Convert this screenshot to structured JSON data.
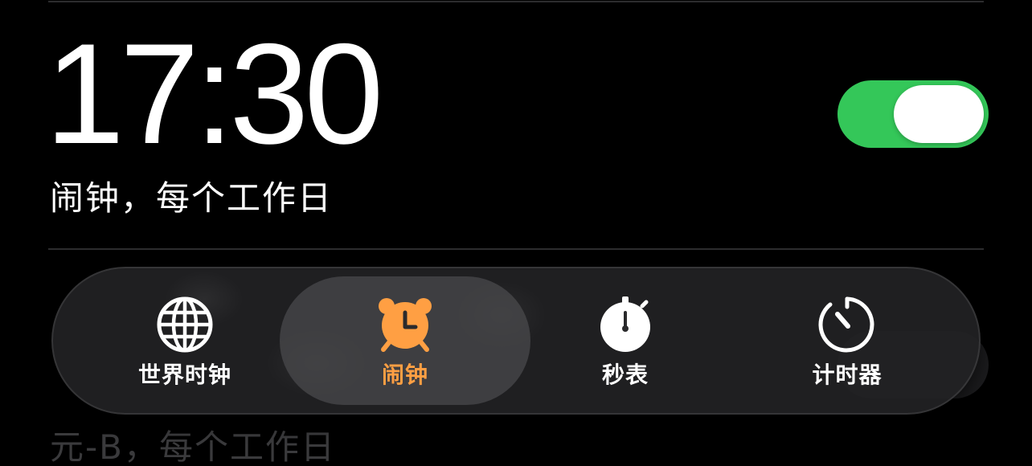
{
  "alarms": [
    {
      "time": "17:30",
      "label": "闹钟，每个工作日",
      "enabled": true
    },
    {
      "label": "元-B，每个工作日"
    }
  ],
  "tabbar": {
    "tabs": [
      {
        "label": "世界时钟",
        "icon": "globe-icon",
        "active": false
      },
      {
        "label": "闹钟",
        "icon": "alarm-clock-icon",
        "active": true
      },
      {
        "label": "秒表",
        "icon": "stopwatch-icon",
        "active": false
      },
      {
        "label": "计时器",
        "icon": "timer-icon",
        "active": false
      }
    ]
  },
  "colors": {
    "toggle_on": "#34c759",
    "active_tab": "#ff9f43",
    "background": "#000000"
  }
}
